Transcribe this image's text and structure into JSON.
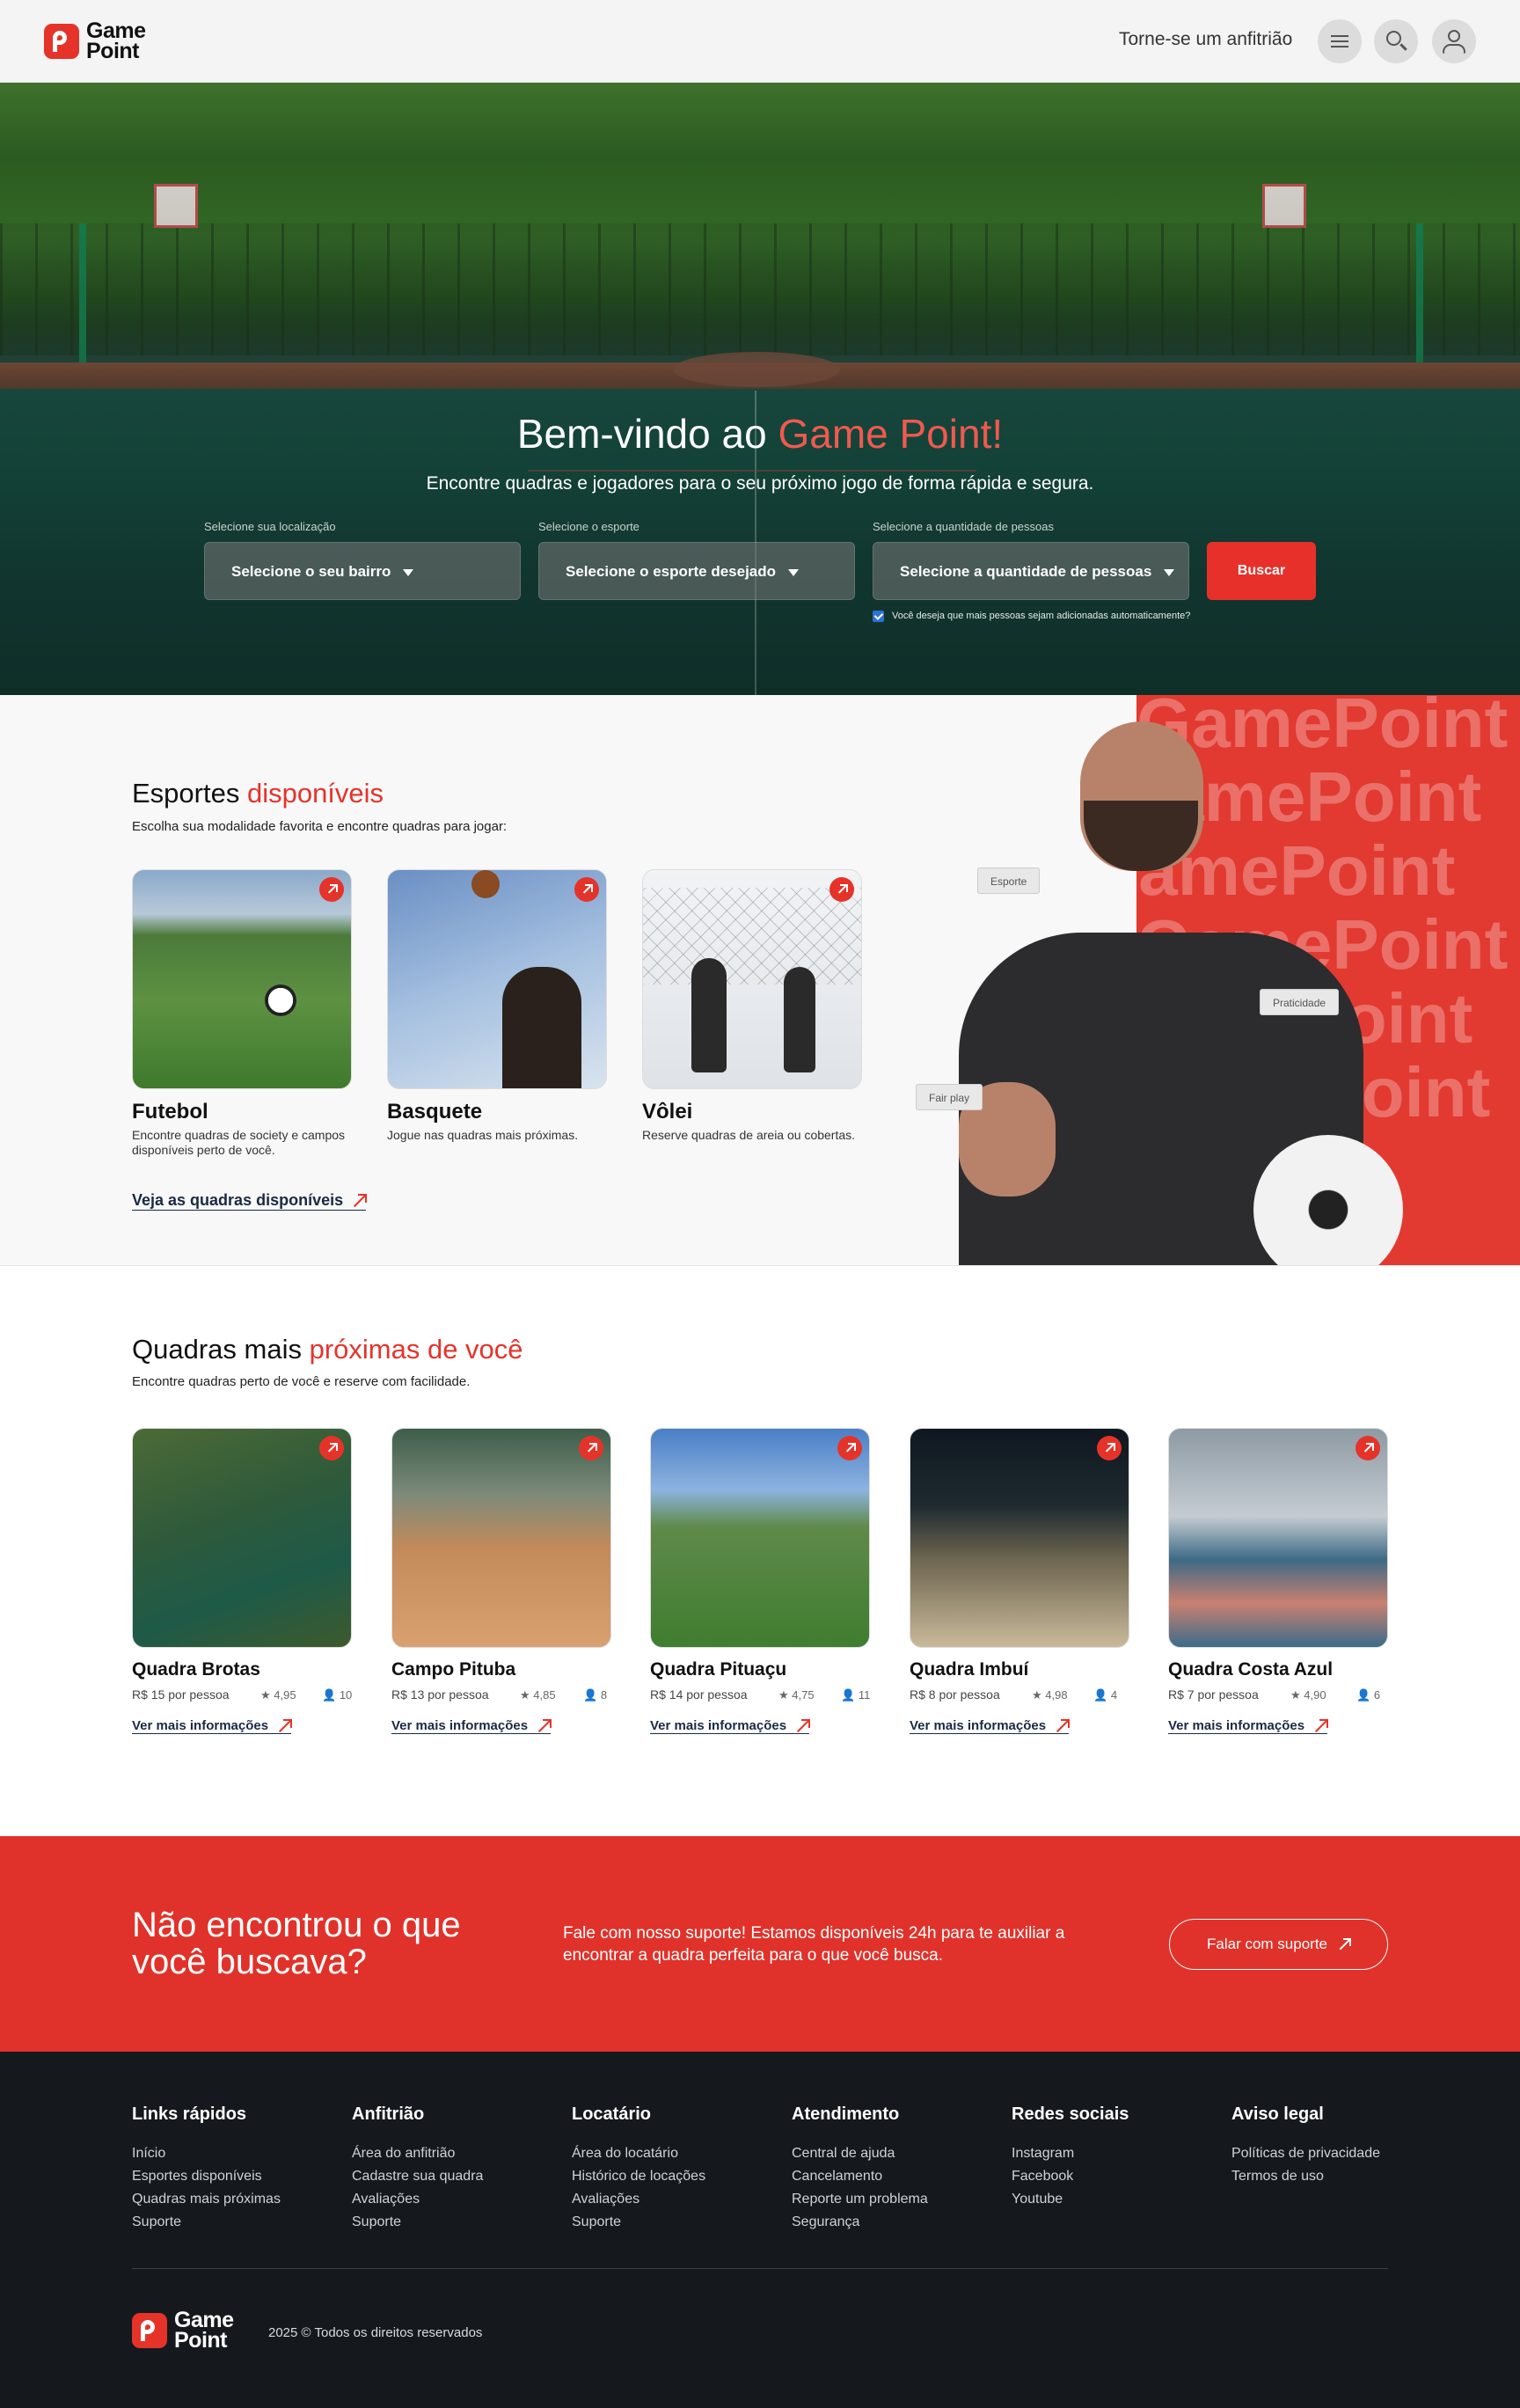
{
  "header": {
    "logo_line1": "Game",
    "logo_line2": "Point",
    "host_link": "Torne-se um anfitrião",
    "icons": [
      "menu-icon",
      "search-icon",
      "user-icon"
    ]
  },
  "hero": {
    "title_prefix": "Bem-vindo ao ",
    "title_highlight": "Game Point!",
    "subtitle": "Encontre quadras e jogadores para o seu próximo jogo de forma rápida e segura.",
    "location_label": "Selecione sua localização",
    "location_value": "Selecione o seu bairro",
    "sport_label": "Selecione o esporte",
    "sport_value": "Selecione o esporte desejado",
    "people_label": "Selecione a quantidade de pessoas",
    "people_value": "Selecione a quantidade de pessoas",
    "search_button": "Buscar",
    "checkbox_label": "Você deseja que mais pessoas sejam adicionadas automaticamente?",
    "checkbox_checked": true
  },
  "sports": {
    "title_prefix": "Esportes ",
    "title_highlight": "disponíveis",
    "subtitle": "Escolha sua modalidade favorita e encontre quadras para jogar:",
    "cards": [
      {
        "title": "Futebol",
        "desc": "Encontre quadras de society e campos disponíveis perto de você."
      },
      {
        "title": "Basquete",
        "desc": "Jogue nas quadras mais próximas."
      },
      {
        "title": "Vôlei",
        "desc": "Reserve quadras de areia ou cobertas."
      }
    ],
    "link": "Veja as quadras disponíveis",
    "watermark_a": "Game",
    "watermark_b": "Point",
    "tags": [
      "Esporte",
      "Praticidade",
      "Fair play"
    ]
  },
  "nearby": {
    "title_prefix": "Quadras mais ",
    "title_highlight": "próximas de você",
    "subtitle": "Encontre quadras perto de você e reserve com facilidade.",
    "more_label": "Ver mais informações",
    "courts": [
      {
        "name": "Quadra Brotas",
        "price": "R$ 15 por pessoa",
        "rating": "4,95",
        "people": "10"
      },
      {
        "name": "Campo Pituba",
        "price": "R$ 13 por pessoa",
        "rating": "4,85",
        "people": "8"
      },
      {
        "name": "Quadra Pituaçu",
        "price": "R$ 14 por pessoa",
        "rating": "4,75",
        "people": "11"
      },
      {
        "name": "Quadra Imbuí",
        "price": "R$ 8 por pessoa",
        "rating": "4,98",
        "people": "4"
      },
      {
        "name": "Quadra Costa Azul",
        "price": "R$ 7 por pessoa",
        "rating": "4,90",
        "people": "6"
      }
    ]
  },
  "cta": {
    "title": "Não encontrou o que você buscava?",
    "text": "Fale com nosso suporte! Estamos disponíveis 24h para te auxiliar a encontrar a quadra perfeita para o que você busca.",
    "button": "Falar com suporte"
  },
  "footer": {
    "columns": [
      {
        "title": "Links rápidos",
        "items": [
          "Início",
          "Esportes disponíveis",
          "Quadras mais próximas",
          "Suporte"
        ]
      },
      {
        "title": "Anfitrião",
        "items": [
          "Área do anfitrião",
          "Cadastre sua quadra",
          "Avaliações",
          "Suporte"
        ]
      },
      {
        "title": "Locatário",
        "items": [
          "Área do locatário",
          "Histórico de locações",
          "Avaliações",
          "Suporte"
        ]
      },
      {
        "title": "Atendimento",
        "items": [
          "Central de ajuda",
          "Cancelamento",
          "Reporte um problema",
          "Segurança"
        ]
      },
      {
        "title": "Redes sociais",
        "items": [
          "Instagram",
          "Facebook",
          "Youtube"
        ]
      },
      {
        "title": "Aviso legal",
        "items": [
          "Políticas de privacidade",
          "Termos de uso"
        ]
      }
    ],
    "copyright": "2025 © Todos os direitos reservados"
  },
  "colors": {
    "accent": "#e5332a",
    "footer_bg": "#15191e",
    "hero_green": "#1a5a4c"
  }
}
